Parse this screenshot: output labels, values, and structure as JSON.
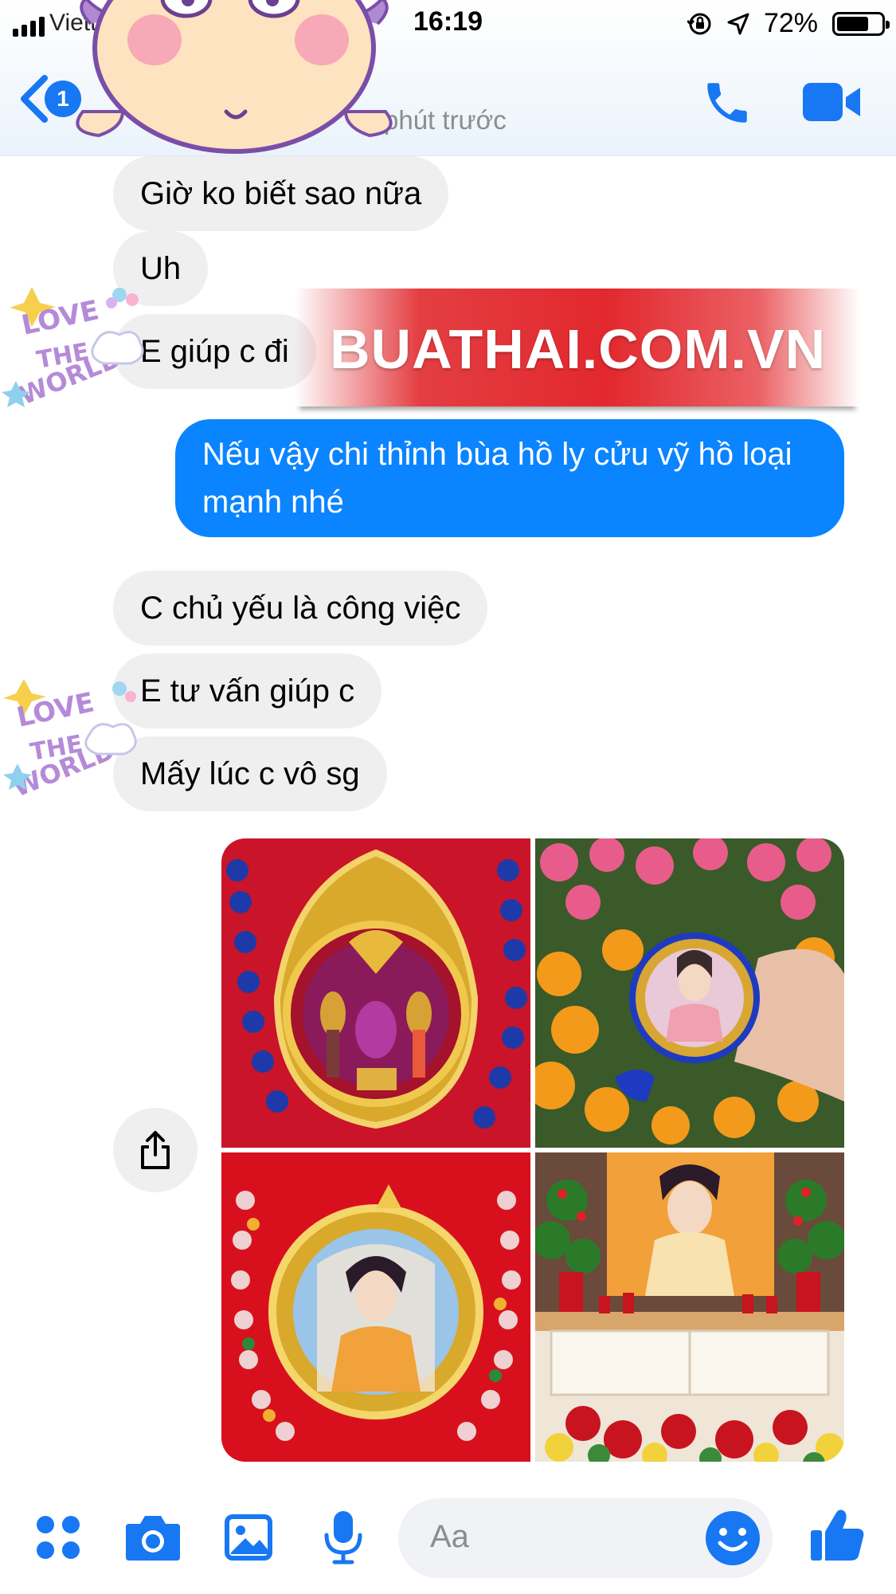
{
  "status_bar": {
    "carrier": "Viett",
    "time": "16:19",
    "battery": "72%",
    "battery_level": 0.72
  },
  "header": {
    "back_badge": "1",
    "subtitle": "phút trước"
  },
  "messages": [
    {
      "side": "in",
      "text": "Giờ ko biết sao nữa"
    },
    {
      "side": "in",
      "text": "Uh"
    },
    {
      "side": "in",
      "text": "E giúp c đi"
    },
    {
      "side": "out",
      "text": "Nếu vậy chi thỉnh bùa hồ ly cửu vỹ hồ loại mạnh nhé"
    },
    {
      "side": "in",
      "text": "C chủ yếu là công việc"
    },
    {
      "side": "in",
      "text": "E tư vấn giúp c"
    },
    {
      "side": "in",
      "text": "Mấy lúc c vô sg"
    }
  ],
  "watermark": "BUATHAI.COM.VN",
  "composer": {
    "placeholder": "Aa"
  },
  "colors": {
    "accent": "#0a84ff",
    "incoming_bubble": "#efefef",
    "watermark_red": "#e2282e"
  },
  "icons": [
    "signal-icon",
    "orientation-lock-icon",
    "location-icon",
    "battery-icon",
    "back-chevron-icon",
    "phone-icon",
    "video-camera-icon",
    "share-icon",
    "apps-icon",
    "camera-icon",
    "gallery-icon",
    "microphone-icon",
    "emoji-icon",
    "like-icon"
  ]
}
